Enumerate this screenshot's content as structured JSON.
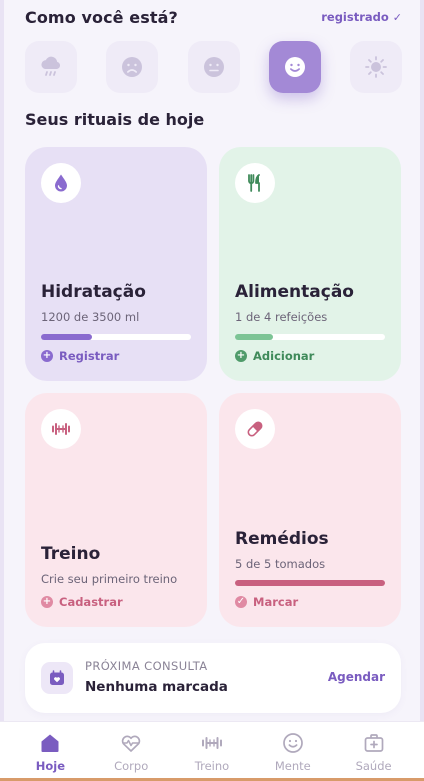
{
  "mood": {
    "title": "Como você está?",
    "status": "registrado",
    "status_check": "✓",
    "options": [
      {
        "icon": "rain-cloud-icon"
      },
      {
        "icon": "sad-face-icon"
      },
      {
        "icon": "neutral-face-icon"
      },
      {
        "icon": "happy-face-icon",
        "selected": true
      },
      {
        "icon": "sun-icon"
      }
    ]
  },
  "rituals": {
    "title": "Seus rituais de hoje",
    "hydration": {
      "title": "Hidratação",
      "subtitle": "1200 de 3500 ml",
      "progress": 0.34,
      "action": "Registrar",
      "action_symbol": "+",
      "accent": "#8a6bcf"
    },
    "food": {
      "title": "Alimentação",
      "subtitle": "1 de 4 refeições",
      "progress": 0.25,
      "action": "Adicionar",
      "action_symbol": "+",
      "accent": "#4f9b6a"
    },
    "workout": {
      "title": "Treino",
      "subtitle": "Crie seu primeiro treino",
      "action": "Cadastrar",
      "action_symbol": "+",
      "accent": "#c8607f"
    },
    "meds": {
      "title": "Remédios",
      "subtitle": "5 de 5 tomados",
      "progress": 1.0,
      "action": "Marcar",
      "action_symbol": "✓",
      "accent": "#c8607f"
    }
  },
  "consult": {
    "label": "PRÓXIMA CONSULTA",
    "value": "Nenhuma marcada",
    "action": "Agendar"
  },
  "nav": {
    "items": [
      {
        "label": "Hoje",
        "icon": "home-icon",
        "active": true
      },
      {
        "label": "Corpo",
        "icon": "heart-pulse-icon"
      },
      {
        "label": "Treino",
        "icon": "dumbbell-icon"
      },
      {
        "label": "Mente",
        "icon": "smile-icon"
      },
      {
        "label": "Saúde",
        "icon": "medical-kit-icon"
      }
    ]
  },
  "colors": {
    "primary": "#7a5cc0",
    "mood_active": "#a389d6",
    "hydration_bg": "#e7e0f5",
    "food_bg": "#e2f3e8",
    "pink_bg": "#fbe6ec"
  }
}
